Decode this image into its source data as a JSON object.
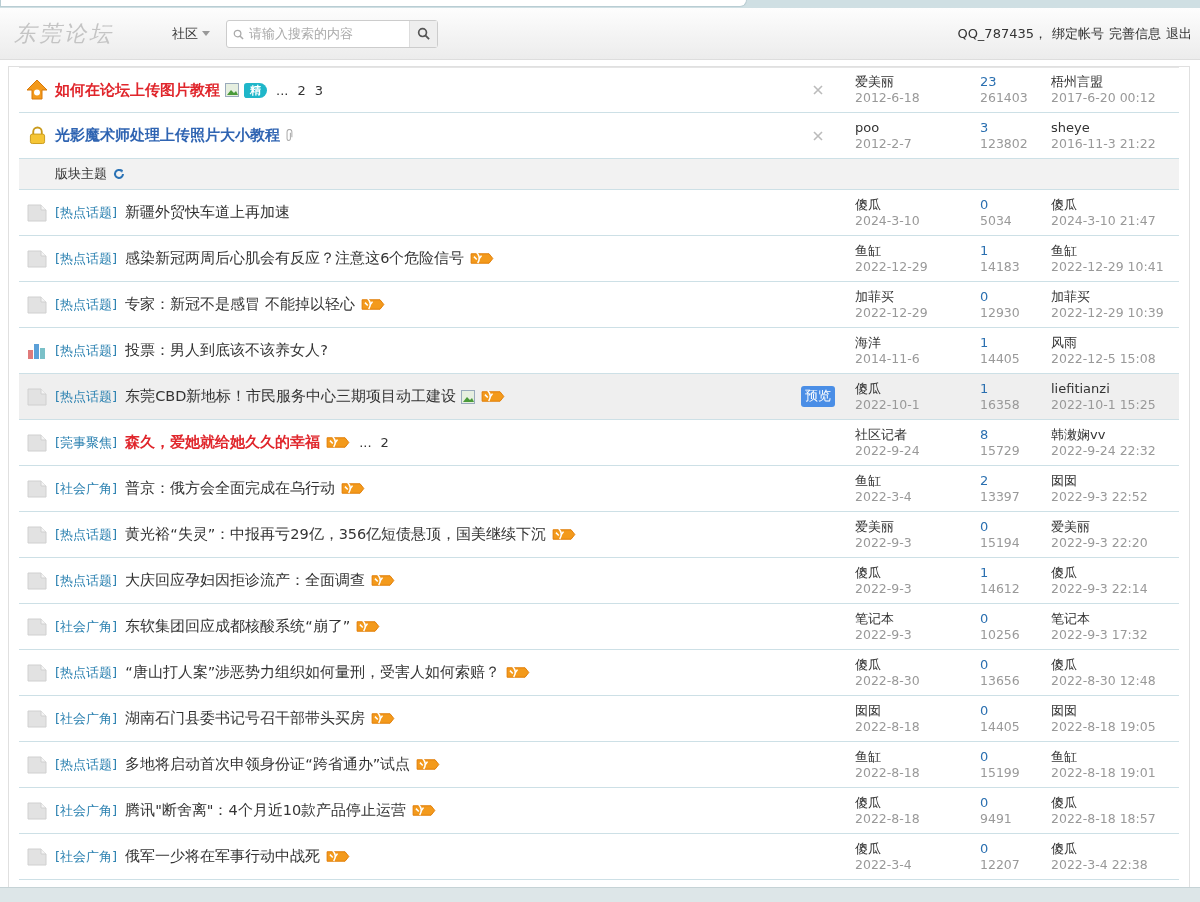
{
  "header": {
    "logo": "东莞论坛",
    "nav": {
      "label": "社区"
    },
    "search": {
      "placeholder": "请输入搜索的内容"
    },
    "user": {
      "name": "QQ_787435，",
      "links": [
        "绑定帐号",
        "完善信息",
        "退出"
      ]
    }
  },
  "pinned": [
    {
      "kind": "sticky",
      "title": "如何在论坛上传图片教程",
      "image": true,
      "attachment": false,
      "digest": "精",
      "pages": [
        "...",
        "2",
        "3"
      ],
      "author": "爱美丽",
      "date": "2012-6-18",
      "replies": "23",
      "views": "261403",
      "last_user": "梧州言盟",
      "last_time": "2017-6-20 00:12"
    },
    {
      "kind": "locked",
      "title": "光影魔术师处理上传照片大小教程",
      "image": false,
      "attachment": true,
      "author": "poo",
      "date": "2012-2-7",
      "replies": "3",
      "views": "123802",
      "last_user": "sheye",
      "last_time": "2016-11-3 21:22"
    }
  ],
  "section": {
    "title": "版块主题"
  },
  "threads": [
    {
      "kind": "normal",
      "category": "[热点话题]",
      "title": "新疆外贸快车道上再加速",
      "red": false,
      "image": false,
      "hot": false,
      "selected": false,
      "author": "傻瓜",
      "date": "2024-3-10",
      "replies": "0",
      "views": "5034",
      "last_user": "傻瓜",
      "last_time": "2024-3-10 21:47"
    },
    {
      "kind": "normal",
      "category": "[热点话题]",
      "title": "感染新冠两周后心肌会有反应？注意这6个危险信号",
      "red": false,
      "image": false,
      "hot": true,
      "selected": false,
      "author": "鱼缸",
      "date": "2022-12-29",
      "replies": "1",
      "views": "14183",
      "last_user": "鱼缸",
      "last_time": "2022-12-29 10:41"
    },
    {
      "kind": "normal",
      "category": "[热点话题]",
      "title": "专家：新冠不是感冒 不能掉以轻心",
      "red": false,
      "image": false,
      "hot": true,
      "selected": false,
      "author": "加菲买",
      "date": "2022-12-29",
      "replies": "0",
      "views": "12930",
      "last_user": "加菲买",
      "last_time": "2022-12-29 10:39"
    },
    {
      "kind": "poll",
      "category": "[热点话题]",
      "title": "投票：男人到底该不该养女人?",
      "red": false,
      "image": false,
      "hot": false,
      "selected": false,
      "author": "海洋",
      "date": "2014-11-6",
      "replies": "1",
      "views": "14405",
      "last_user": "风雨",
      "last_time": "2022-12-5 15:08"
    },
    {
      "kind": "normal",
      "category": "[热点话题]",
      "title": "东莞CBD新地标！市民服务中心三期项目动工建设",
      "red": false,
      "image": true,
      "hot": true,
      "selected": true,
      "preview": "预览",
      "author": "傻瓜",
      "date": "2022-10-1",
      "replies": "1",
      "views": "16358",
      "last_user": "liefitianzi",
      "last_time": "2022-10-1 15:25"
    },
    {
      "kind": "normal",
      "category": "[莞事聚焦]",
      "title": "森久，爱她就给她久久的幸福",
      "red": true,
      "image": false,
      "hot": true,
      "pages": [
        "...",
        "2"
      ],
      "selected": false,
      "author": "社区记者",
      "date": "2022-9-24",
      "replies": "8",
      "views": "15729",
      "last_user": "韩潄娴vv",
      "last_time": "2022-9-24 22:32"
    },
    {
      "kind": "normal",
      "category": "[社会广角]",
      "title": "普京：俄方会全面完成在乌行动",
      "red": false,
      "image": false,
      "hot": true,
      "selected": false,
      "author": "鱼缸",
      "date": "2022-3-4",
      "replies": "2",
      "views": "13397",
      "last_user": "囡囡",
      "last_time": "2022-9-3 22:52"
    },
    {
      "kind": "normal",
      "category": "[热点话题]",
      "title": "黄光裕“失灵”：中报再亏29亿，356亿短债悬顶，国美继续下沉",
      "red": false,
      "image": false,
      "hot": true,
      "selected": false,
      "author": "爱美丽",
      "date": "2022-9-3",
      "replies": "0",
      "views": "15194",
      "last_user": "爱美丽",
      "last_time": "2022-9-3 22:20"
    },
    {
      "kind": "normal",
      "category": "[热点话题]",
      "title": "大庆回应孕妇因拒诊流产：全面调查",
      "red": false,
      "image": false,
      "hot": true,
      "selected": false,
      "author": "傻瓜",
      "date": "2022-9-3",
      "replies": "1",
      "views": "14612",
      "last_user": "傻瓜",
      "last_time": "2022-9-3 22:14"
    },
    {
      "kind": "normal",
      "category": "[社会广角]",
      "title": "东软集团回应成都核酸系统“崩了”",
      "red": false,
      "image": false,
      "hot": true,
      "selected": false,
      "author": "笔记本",
      "date": "2022-9-3",
      "replies": "0",
      "views": "10256",
      "last_user": "笔记本",
      "last_time": "2022-9-3 17:32"
    },
    {
      "kind": "normal",
      "category": "[热点话题]",
      "title": "“唐山打人案”涉恶势力组织如何量刑，受害人如何索赔？",
      "red": false,
      "image": false,
      "hot": true,
      "selected": false,
      "author": "傻瓜",
      "date": "2022-8-30",
      "replies": "0",
      "views": "13656",
      "last_user": "傻瓜",
      "last_time": "2022-8-30 12:48"
    },
    {
      "kind": "normal",
      "category": "[社会广角]",
      "title": "湖南石门县委书记号召干部带头买房",
      "red": false,
      "image": false,
      "hot": true,
      "selected": false,
      "author": "囡囡",
      "date": "2022-8-18",
      "replies": "0",
      "views": "14405",
      "last_user": "囡囡",
      "last_time": "2022-8-18 19:05"
    },
    {
      "kind": "normal",
      "category": "[热点话题]",
      "title": "多地将启动首次申领身份证“跨省通办”试点",
      "red": false,
      "image": false,
      "hot": true,
      "selected": false,
      "author": "鱼缸",
      "date": "2022-8-18",
      "replies": "0",
      "views": "15199",
      "last_user": "鱼缸",
      "last_time": "2022-8-18 19:01"
    },
    {
      "kind": "normal",
      "category": "[社会广角]",
      "title": "腾讯\"断舍离\"：4个月近10款产品停止运营",
      "red": false,
      "image": false,
      "hot": true,
      "selected": false,
      "author": "傻瓜",
      "date": "2022-8-18",
      "replies": "0",
      "views": "9491",
      "last_user": "傻瓜",
      "last_time": "2022-8-18 18:57"
    },
    {
      "kind": "normal",
      "category": "[社会广角]",
      "title": "俄军一少将在军事行动中战死",
      "red": false,
      "image": false,
      "hot": true,
      "selected": false,
      "author": "傻瓜",
      "date": "2022-3-4",
      "replies": "0",
      "views": "12207",
      "last_user": "傻瓜",
      "last_time": "2022-3-4 22:38"
    }
  ]
}
